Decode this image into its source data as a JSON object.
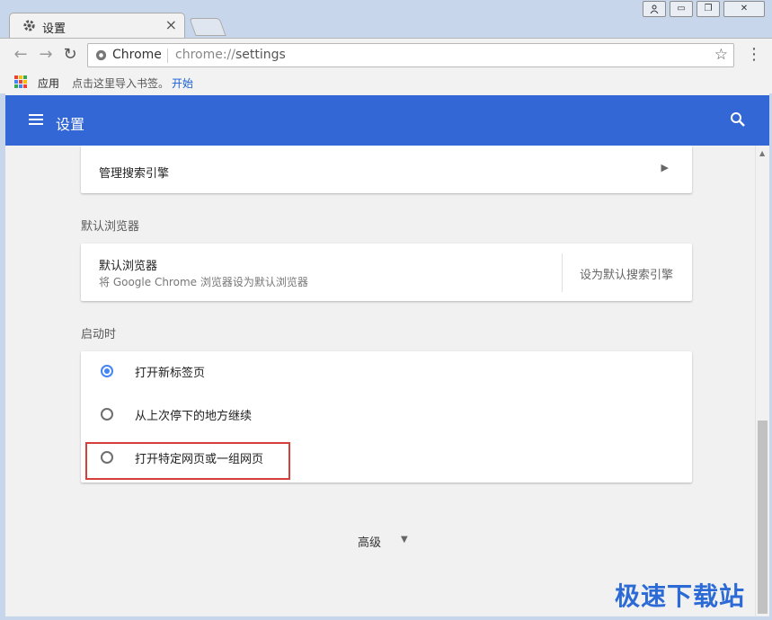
{
  "window": {
    "tab_title": "设置",
    "tab_close": "×",
    "user_icon": "person-icon",
    "minimize": "▭",
    "maximize": "❐",
    "close": "✕"
  },
  "toolbar": {
    "back": "←",
    "forward": "→",
    "reload": "↻",
    "site_name": "Chrome",
    "url_scheme": "chrome://",
    "url_path": "settings",
    "star": "☆",
    "menu": "⋮"
  },
  "bookmarks": {
    "apps_label": "应用",
    "hint": "点击这里导入书签。",
    "start_link": "开始",
    "apps_colors": [
      "#ea4335",
      "#fbbc05",
      "#34a853",
      "#4285f4",
      "#ea4335",
      "#fbbc05",
      "#34a853",
      "#4285f4",
      "#ea4335"
    ]
  },
  "header": {
    "title": "设置",
    "bg_color": "#3367d6"
  },
  "content": {
    "search_engine_manage": "管理搜索引擎",
    "default_browser_section": "默认浏览器",
    "default_browser_primary": "默认浏览器",
    "default_browser_secondary": "将 Google Chrome 浏览器设为默认浏览器",
    "default_browser_action": "设为默认搜索引擎",
    "startup_section": "启动时",
    "startup_options": [
      {
        "label": "打开新标签页",
        "checked": true
      },
      {
        "label": "从上次停下的地方继续",
        "checked": false
      },
      {
        "label": "打开特定网页或一组网页",
        "checked": false
      }
    ],
    "advanced": "高级"
  },
  "watermark": "极速下载站"
}
